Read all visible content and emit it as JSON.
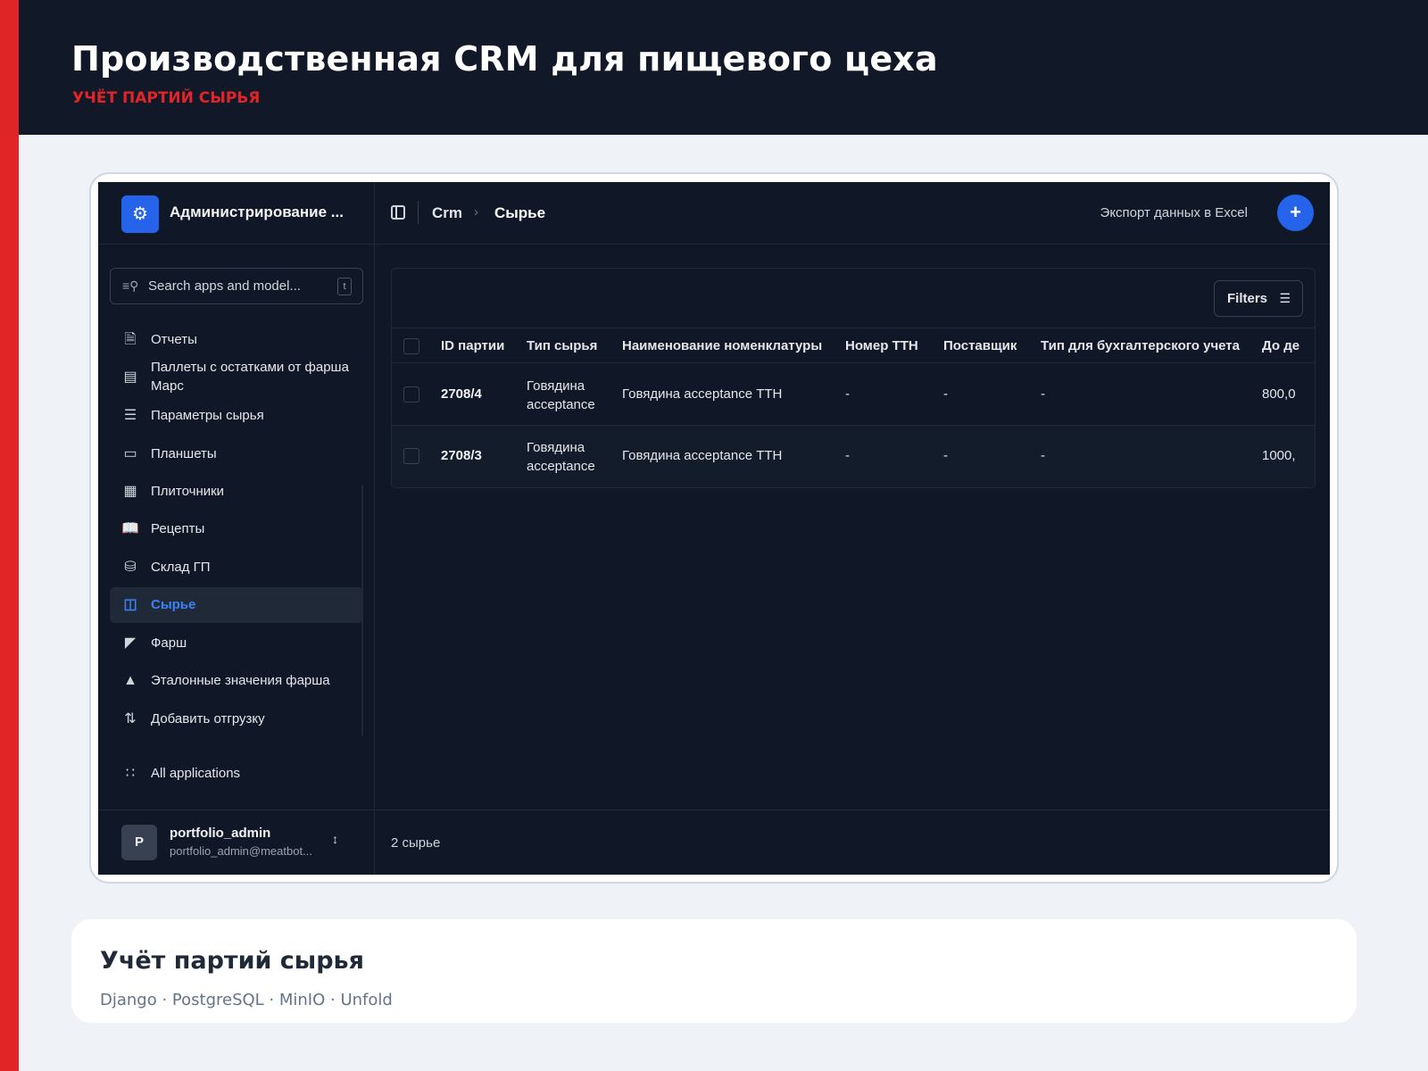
{
  "header": {
    "title": "Производственная CRM для пищевого цеха",
    "subtitle": "УЧЁТ ПАРТИЙ СЫРЬЯ"
  },
  "app": {
    "brand": {
      "name": "Администрирование ...",
      "icon": "gear-icon"
    },
    "search": {
      "placeholder": "Search apps and model...",
      "shortcut": "t"
    },
    "sidebar": {
      "items": [
        {
          "label": "Отчеты",
          "icon": "document-icon",
          "active": false
        },
        {
          "label": "Паллеты с остатками от фарша Марс",
          "icon": "pallet-icon",
          "active": false
        },
        {
          "label": "Параметры сырья",
          "icon": "sliders-icon",
          "active": false
        },
        {
          "label": "Планшеты",
          "icon": "tablet-icon",
          "active": false
        },
        {
          "label": "Плиточники",
          "icon": "grid-icon",
          "active": false
        },
        {
          "label": "Рецепты",
          "icon": "book-icon",
          "active": false
        },
        {
          "label": "Склад ГП",
          "icon": "database-icon",
          "active": false
        },
        {
          "label": "Сырье",
          "icon": "archive-icon",
          "active": true
        },
        {
          "label": "Фарш",
          "icon": "factory-icon",
          "active": false
        },
        {
          "label": "Эталонные значения фарша",
          "icon": "flask-icon",
          "active": false
        },
        {
          "label": "Добавить отгрузку",
          "icon": "sort-icon",
          "active": false
        }
      ],
      "all_apps": {
        "label": "All applications",
        "icon": "apps-grid-icon"
      }
    },
    "user": {
      "initial": "P",
      "name": "portfolio_admin",
      "email": "portfolio_admin@meatbot..."
    },
    "topbar": {
      "breadcrumb": [
        "Crm",
        "Сырье"
      ],
      "export_label": "Экспорт данных в Excel",
      "add_label": "+"
    },
    "filters_label": "Filters",
    "table": {
      "columns": [
        "ID партии",
        "Тип сырья",
        "Наименование номенклатуры",
        "Номер ТТН",
        "Поставщик",
        "Тип для бухгалтерского учета",
        "До де"
      ],
      "rows": [
        {
          "id": "2708/4",
          "type": "Говядина acceptance",
          "name": "Говядина acceptance ТТН",
          "ttn": "-",
          "supplier": "-",
          "accounting_type": "-",
          "extra": "800,0"
        },
        {
          "id": "2708/3",
          "type": "Говядина acceptance",
          "name": "Говядина acceptance ТТН",
          "ttn": "-",
          "supplier": "-",
          "accounting_type": "-",
          "extra": "1000,"
        }
      ]
    },
    "footer_count": "2 сырье"
  },
  "caption": {
    "title": "Учёт партий сырья",
    "stack": "Django · PostgreSQL · MinIO · Unfold"
  },
  "colors": {
    "accent": "#e02528",
    "primary": "#2563eb",
    "background_dark": "#101828",
    "hero_dark": "#111827"
  }
}
